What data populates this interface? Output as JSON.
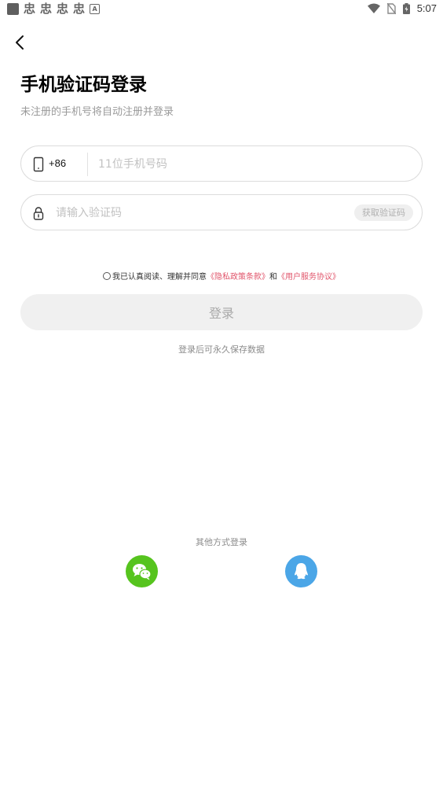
{
  "status_bar": {
    "time": "5:07",
    "notification_icons": [
      "app-icon",
      "notification-glyph",
      "notification-glyph",
      "notification-glyph",
      "notification-glyph",
      "a-icon"
    ],
    "notification_glyph": "忠",
    "a_label": "A"
  },
  "header": {
    "title": "手机验证码登录",
    "subtitle": "未注册的手机号将自动注册并登录"
  },
  "phone_field": {
    "country_code": "+86",
    "placeholder": "11位手机号码",
    "value": ""
  },
  "code_field": {
    "placeholder": "请输入验证码",
    "value": "",
    "get_code_label": "获取验证码"
  },
  "agreement": {
    "checked": false,
    "prefix": "我已认真阅读、理解并同意",
    "privacy_link": "《隐私政策条款》",
    "conjunction": "和",
    "service_link": "《用户服务协议》"
  },
  "login_button": {
    "label": "登录"
  },
  "save_note": "登录后可永久保存数据",
  "other_login": {
    "label": "其他方式登录",
    "providers": [
      "wechat-icon",
      "qq-icon"
    ]
  },
  "colors": {
    "accent_link": "#e1556b",
    "wechat": "#56c41e",
    "qq": "#4ba6e7",
    "disabled_button_bg": "#f0f0f0"
  }
}
